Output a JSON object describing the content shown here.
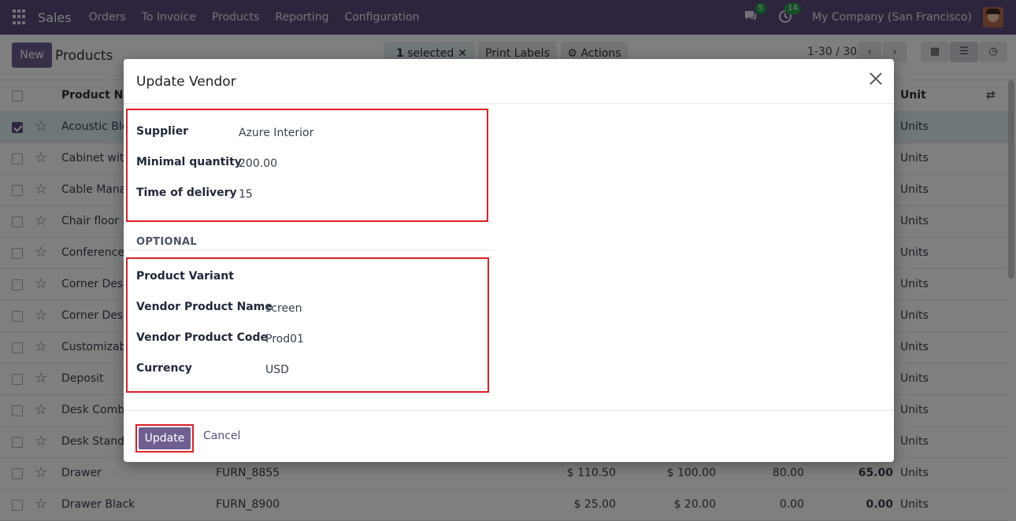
{
  "navbar": {
    "app_name": "Sales",
    "menu": [
      "Orders",
      "To Invoice",
      "Products",
      "Reporting",
      "Configuration"
    ],
    "messages_badge": "5",
    "activities_badge": "14",
    "company": "My Company (San Francisco)"
  },
  "control": {
    "new_label": "New",
    "title": "Products",
    "selected_count": "1",
    "selected_text": "selected",
    "print_labels": "Print Labels",
    "actions": "Actions",
    "pager": "1-30 / 30"
  },
  "list": {
    "headers": {
      "product_name": "Product Name",
      "unit": "Unit"
    },
    "rows": [
      {
        "name": "Acoustic Bloc",
        "unit": "Units",
        "checked": true
      },
      {
        "name": "Cabinet with",
        "unit": "Units"
      },
      {
        "name": "Cable Manag",
        "unit": "Units"
      },
      {
        "name": "Chair floor p",
        "unit": "Units"
      },
      {
        "name": "Conference C",
        "unit": "Units"
      },
      {
        "name": "Corner Desk",
        "unit": "Units"
      },
      {
        "name": "Corner Desk",
        "unit": "Units"
      },
      {
        "name": "Customizabl",
        "unit": "Units"
      },
      {
        "name": "Deposit",
        "unit": "Units"
      },
      {
        "name": "Desk Combir",
        "unit": "Units"
      },
      {
        "name": "Desk Stand v",
        "unit": "Units"
      },
      {
        "name": "Drawer",
        "ref": "FURN_8855",
        "price": "$ 110.50",
        "cost": "$ 100.00",
        "qty": "80.00",
        "forecast": "65.00",
        "unit": "Units"
      },
      {
        "name": "Drawer Black",
        "ref": "FURN_8900",
        "price": "$ 25.00",
        "cost": "$ 20.00",
        "qty": "0.00",
        "forecast": "0.00",
        "unit": "Units"
      }
    ]
  },
  "modal": {
    "title": "Update Vendor",
    "supplier_label": "Supplier",
    "supplier_value": "Azure Interior",
    "min_qty_label": "Minimal quantity",
    "min_qty_value": "200.00",
    "delivery_label": "Time of delivery",
    "delivery_value": "15",
    "optional_title": "OPTIONAL",
    "variant_label": "Product Variant",
    "vendor_name_label": "Vendor Product Name",
    "vendor_name_value": "screen",
    "vendor_code_label": "Vendor Product Code",
    "vendor_code_value": "Prod01",
    "currency_label": "Currency",
    "currency_value": "USD",
    "update_label": "Update",
    "cancel_label": "Cancel"
  },
  "colors": {
    "navbar": "#5b4b7a",
    "primary_button": "#6f5f91",
    "highlight_border": "#dc1f26",
    "selected_row": "#dfeef3"
  }
}
